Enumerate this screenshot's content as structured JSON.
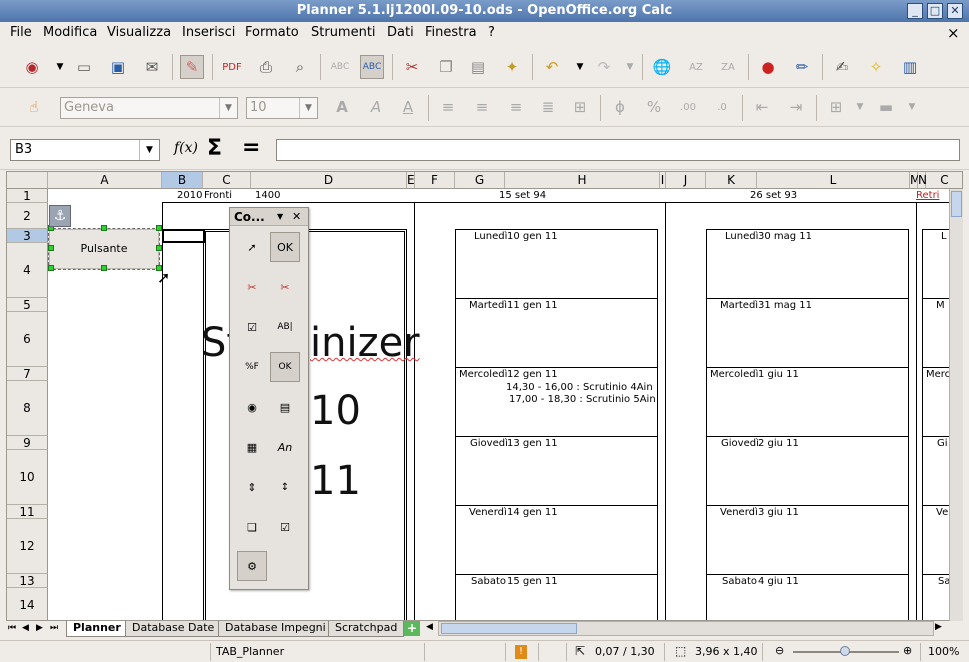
{
  "window": {
    "title": "Planner 5.1.lj1200l.09-10.ods - OpenOffice.org Calc"
  },
  "menu": {
    "items": [
      "File",
      "Modifica",
      "Visualizza",
      "Inserisci",
      "Formato",
      "Strumenti",
      "Dati",
      "Finestra",
      "?"
    ],
    "close": "×"
  },
  "toolbar2": {
    "font_name": "Geneva",
    "font_size": "10"
  },
  "formula": {
    "cell_ref": "B3",
    "fx": "f(x)",
    "sum": "Σ",
    "equals": "="
  },
  "columns": [
    "A",
    "B",
    "C",
    "D",
    "E",
    "F",
    "G",
    "H",
    "I",
    "J",
    "K",
    "L",
    "M",
    "N",
    "C"
  ],
  "rows": [
    "1",
    "2",
    "3",
    "4",
    "5",
    "6",
    "7",
    "8",
    "9",
    "10",
    "11",
    "12",
    "13",
    "14"
  ],
  "cells": {
    "b1": "2010",
    "c1": "Fronti",
    "c1b": "1400",
    "g1": "15 set 94",
    "k1": "26 set 93",
    "n1": "Retri",
    "button_label": "Pulsante",
    "big_start": "St",
    "big_rest": "inizer",
    "big_10": "10",
    "big_11": "11"
  },
  "week1": [
    {
      "day": "Lunedì",
      "date": "10 gen 11"
    },
    {
      "day": "Martedì",
      "date": "11 gen 11"
    },
    {
      "day": "Mercoledì",
      "date": "12 gen 11"
    },
    {
      "day": "Giovedì",
      "date": "13 gen 11"
    },
    {
      "day": "Venerdì",
      "date": "14 gen 11"
    },
    {
      "day": "Sabato",
      "date": "15 gen 11"
    }
  ],
  "week1_events": [
    "14,30 - 16,00 : Scrutinio 4Ain",
    "17,00 - 18,30 : Scrutinio 5Ain"
  ],
  "week2": [
    {
      "day": "Lunedì",
      "date": "30 mag 11"
    },
    {
      "day": "Martedì",
      "date": "31 mag 11"
    },
    {
      "day": "Mercoledì",
      "date": "1 giu 11"
    },
    {
      "day": "Giovedì",
      "date": "2 giu 11"
    },
    {
      "day": "Venerdì",
      "date": "3 giu 11"
    },
    {
      "day": "Sabato",
      "date": "4 giu 11"
    }
  ],
  "week3_partial": [
    "L",
    "M",
    "Merc",
    "Gi",
    "Ve",
    "Sa"
  ],
  "controls_dialog": {
    "title": "Co...",
    "menu_arrow": "▼",
    "close": "✕"
  },
  "sheet_tabs": [
    "Planner",
    "Database Date",
    "Database Impegni",
    "Scratchpad"
  ],
  "status": {
    "sheet": "TAB_Planner",
    "position": "0,07 / 1,30",
    "size": "3,96 x 1,40",
    "zoom": "100%"
  }
}
